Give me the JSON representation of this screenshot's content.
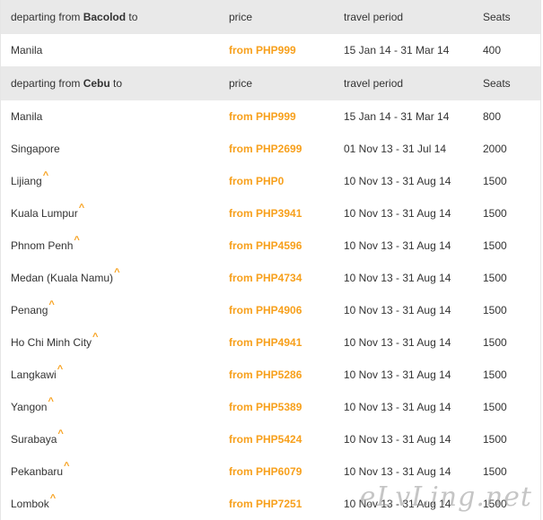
{
  "sections": [
    {
      "header": {
        "prefix": "departing from ",
        "origin": "Bacolod",
        "suffix": " to",
        "price": "price",
        "period": "travel period",
        "seats": "Seats"
      },
      "rows": [
        {
          "destination": "Manila",
          "caret": "",
          "price": "from PHP999",
          "period": "15 Jan 14 - 31 Mar 14",
          "seats": "400"
        }
      ]
    },
    {
      "header": {
        "prefix": "departing from ",
        "origin": "Cebu",
        "suffix": " to",
        "price": "price",
        "period": "travel period",
        "seats": "Seats"
      },
      "rows": [
        {
          "destination": "Manila",
          "caret": "",
          "price": "from PHP999",
          "period": "15 Jan 14 - 31 Mar 14",
          "seats": "800"
        },
        {
          "destination": "Singapore",
          "caret": "",
          "price": "from PHP2699",
          "period": "01 Nov 13 - 31 Jul 14",
          "seats": "2000"
        },
        {
          "destination": "Lijiang",
          "caret": "^",
          "price": "from PHP0",
          "period": "10 Nov 13 - 31 Aug 14",
          "seats": "1500"
        },
        {
          "destination": "Kuala Lumpur",
          "caret": "^",
          "price": "from PHP3941",
          "period": "10 Nov 13 - 31 Aug 14",
          "seats": "1500"
        },
        {
          "destination": "Phnom Penh",
          "caret": "^",
          "price": "from PHP4596",
          "period": "10 Nov 13 - 31 Aug 14",
          "seats": "1500"
        },
        {
          "destination": "Medan (Kuala Namu)",
          "caret": "^",
          "price": "from PHP4734",
          "period": "10 Nov 13 - 31 Aug 14",
          "seats": "1500"
        },
        {
          "destination": "Penang",
          "caret": "^",
          "price": "from PHP4906",
          "period": "10 Nov 13 - 31 Aug 14",
          "seats": "1500"
        },
        {
          "destination": "Ho Chi Minh City",
          "caret": "^",
          "price": "from PHP4941",
          "period": "10 Nov 13 - 31 Aug 14",
          "seats": "1500"
        },
        {
          "destination": "Langkawi",
          "caret": "^",
          "price": "from PHP5286",
          "period": "10 Nov 13 - 31 Aug 14",
          "seats": "1500"
        },
        {
          "destination": "Yangon",
          "caret": "^",
          "price": "from PHP5389",
          "period": "10 Nov 13 - 31 Aug 14",
          "seats": "1500"
        },
        {
          "destination": "Surabaya",
          "caret": "^",
          "price": "from PHP5424",
          "period": "10 Nov 13 - 31 Aug 14",
          "seats": "1500"
        },
        {
          "destination": "Pekanbaru",
          "caret": "^",
          "price": "from PHP6079",
          "period": "10 Nov 13 - 31 Aug 14",
          "seats": "1500"
        },
        {
          "destination": "Lombok",
          "caret": "^",
          "price": "from PHP7251",
          "period": "10 Nov 13 - 31 Aug 14",
          "seats": "1500"
        }
      ]
    }
  ],
  "watermark": "eLvLing.net",
  "colors": {
    "price": "#f7a01c",
    "header_bg": "#e9e9e9",
    "text": "#333333"
  }
}
